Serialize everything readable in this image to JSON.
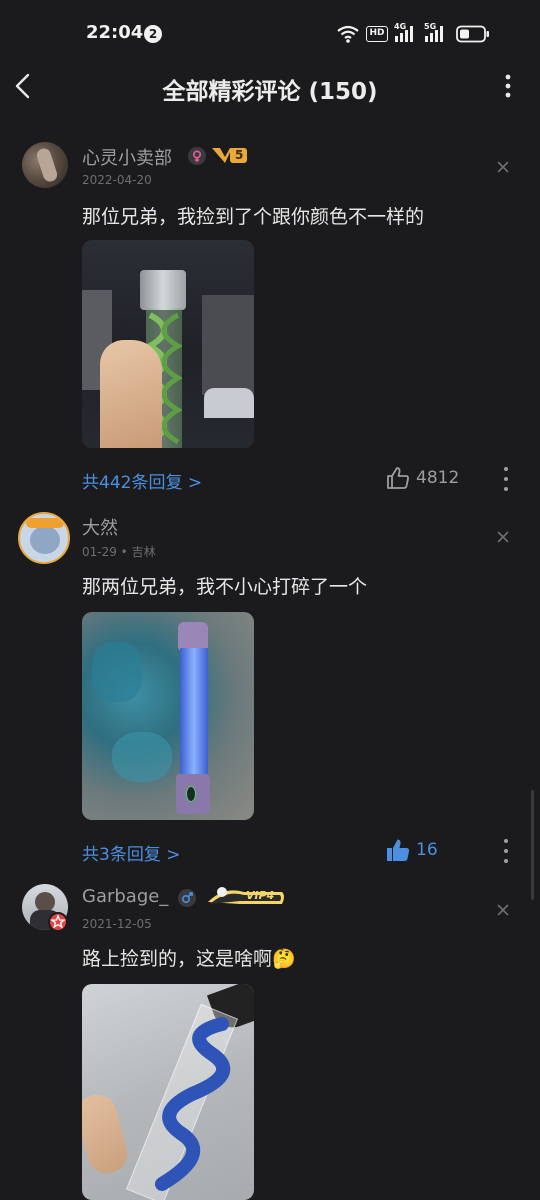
{
  "status_bar": {
    "time": "22:04",
    "notification_count": "2",
    "icons": [
      "wifi-icon",
      "hd-icon",
      "4g-signal-icon",
      "5g-signal-icon",
      "battery-icon"
    ],
    "hd_label": "HD",
    "net_4g": "4G",
    "net_5g": "5G"
  },
  "header": {
    "title": "全部精彩评论 (150)"
  },
  "colors": {
    "background": "#1b1b1d",
    "accent": "#4c8fe0",
    "secondary_text": "#9d9da3",
    "level_gold": "#e8a93a"
  },
  "comments": [
    {
      "username": "心灵小卖部",
      "level": "5",
      "meta": "2022-04-20",
      "text": "那位兄弟，我捡到了个跟你颜色不一样的",
      "replies": "共442条回复 >",
      "likes": "4812",
      "liked": false
    },
    {
      "username": "大然",
      "meta": "01-29 • 吉林",
      "text": "那两位兄弟，我不小心打碎了一个",
      "replies": "共3条回复 >",
      "likes": "16",
      "liked": true
    },
    {
      "username": "Garbage_",
      "vip": "VIP4",
      "meta": "2021-12-05",
      "text": "路上捡到的，这是啥啊🤔",
      "emoji_name": "thinking-face-icon"
    }
  ]
}
